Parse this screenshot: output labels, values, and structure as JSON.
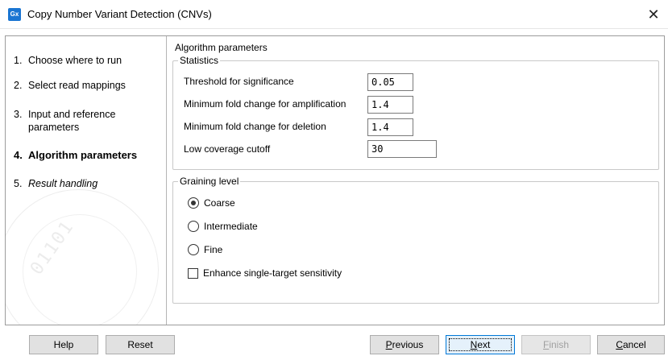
{
  "window": {
    "app_icon_text": "Gx",
    "title": "Copy Number Variant Detection (CNVs)",
    "close_glyph": "✕"
  },
  "sidebar": {
    "steps": [
      {
        "num": "1.",
        "label": "Choose where to run"
      },
      {
        "num": "2.",
        "label": "Select read mappings"
      },
      {
        "num": "3.",
        "label_line1": "Input and reference",
        "label_line2": "parameters"
      },
      {
        "num": "4.",
        "label": "Algorithm parameters"
      },
      {
        "num": "5.",
        "label": "Result handling"
      }
    ],
    "current_step": 4
  },
  "main": {
    "section_title": "Algorithm parameters",
    "statistics": {
      "legend": "Statistics",
      "params": [
        {
          "label": "Threshold for significance",
          "value": "0.05"
        },
        {
          "label": "Minimum fold change for amplification",
          "value": "1.4"
        },
        {
          "label": "Minimum fold change for deletion",
          "value": "1.4"
        },
        {
          "label": "Low coverage cutoff",
          "value": "30"
        }
      ]
    },
    "graining": {
      "legend": "Graining level",
      "options": [
        {
          "label": "Coarse",
          "checked": true
        },
        {
          "label": "Intermediate",
          "checked": false
        },
        {
          "label": "Fine",
          "checked": false
        }
      ],
      "checkbox": {
        "label": "Enhance single-target sensitivity",
        "checked": false
      }
    }
  },
  "footer": {
    "help": "Help",
    "reset": "Reset",
    "previous": {
      "mnemonic": "P",
      "rest": "revious"
    },
    "next": {
      "mnemonic": "N",
      "rest": "ext"
    },
    "finish": {
      "mnemonic": "F",
      "rest": "inish"
    },
    "cancel": {
      "mnemonic": "C",
      "rest": "ancel"
    }
  }
}
